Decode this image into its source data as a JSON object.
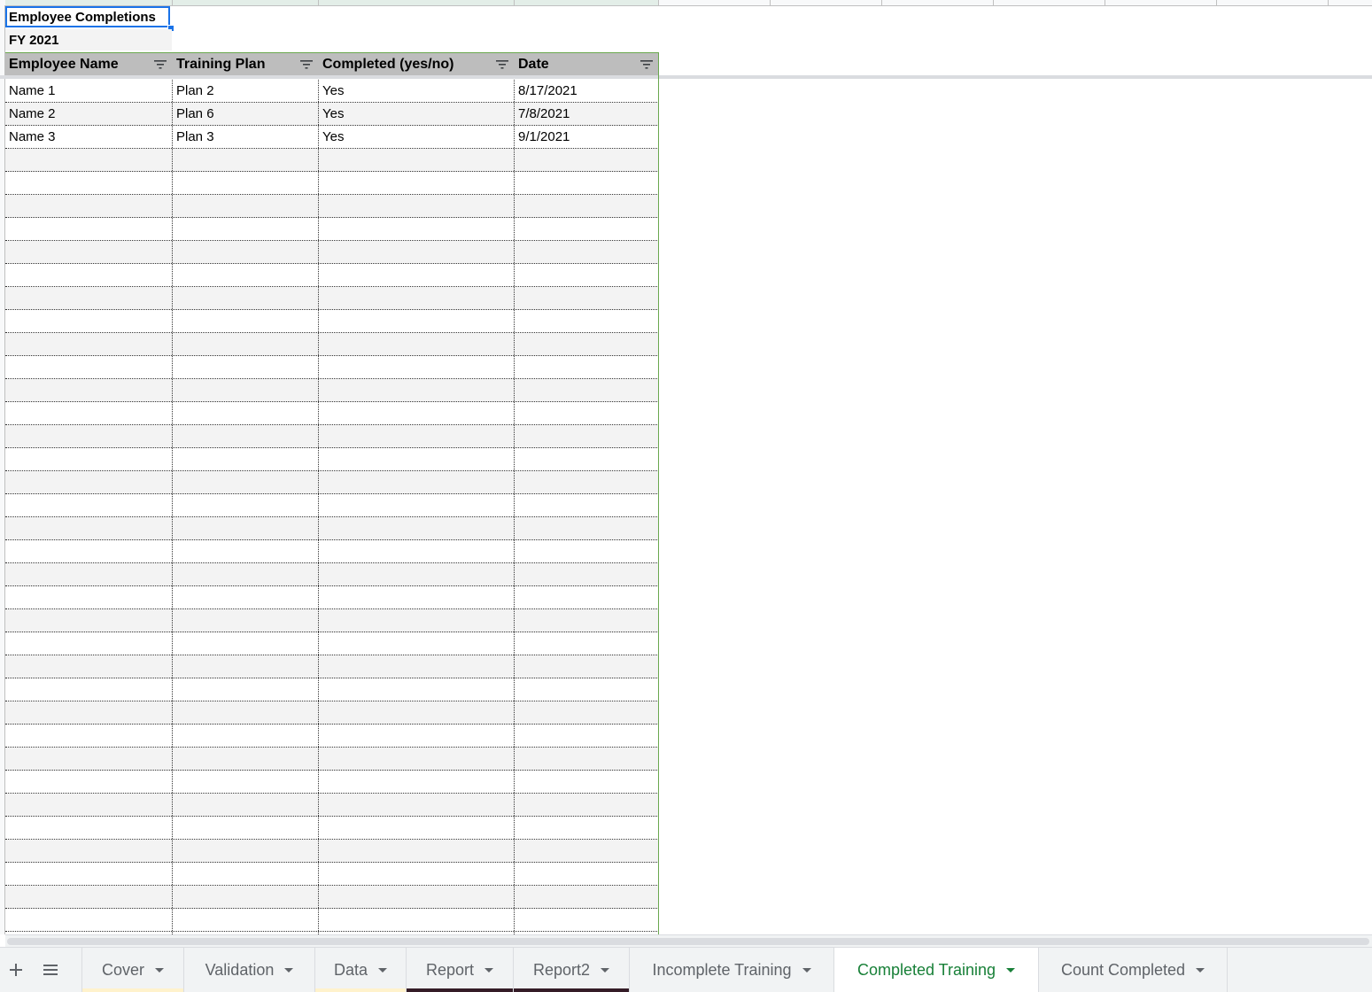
{
  "spreadsheet": {
    "title_cell": "Employee Completions",
    "subtitle_cell": "FY 2021",
    "columns": [
      "Employee Name",
      "Training Plan",
      "Completed (yes/no)",
      "Date"
    ],
    "rows": [
      [
        "Name 1",
        "Plan 2",
        "Yes",
        "8/17/2021"
      ],
      [
        "Name 2",
        "Plan 6",
        "Yes",
        "7/8/2021"
      ],
      [
        "Name 3",
        "Plan 3",
        "Yes",
        "9/1/2021"
      ]
    ],
    "empty_row_count": 34
  },
  "tabbar": {
    "add_sheet_icon": "plus-icon",
    "all_sheets_icon": "list-icon",
    "tabs": [
      {
        "label": "Cover",
        "accent": "#fff2cc"
      },
      {
        "label": "Validation",
        "accent": ""
      },
      {
        "label": "Data",
        "accent": "#fff2cc"
      },
      {
        "label": "Report",
        "accent": "#351c27"
      },
      {
        "label": "Report2",
        "accent": "#351c27"
      },
      {
        "label": "Incomplete Training",
        "accent": ""
      },
      {
        "label": "Completed Training",
        "accent": ""
      },
      {
        "label": "Count Completed",
        "accent": ""
      }
    ],
    "active_tab": "Completed Training"
  },
  "colors": {
    "selection": "#1a73e8",
    "header_bg": "#bdbdbd",
    "alt_row_bg": "#f3f3f3",
    "table_border": "#6aa84f",
    "active_tab_text": "#188038"
  }
}
